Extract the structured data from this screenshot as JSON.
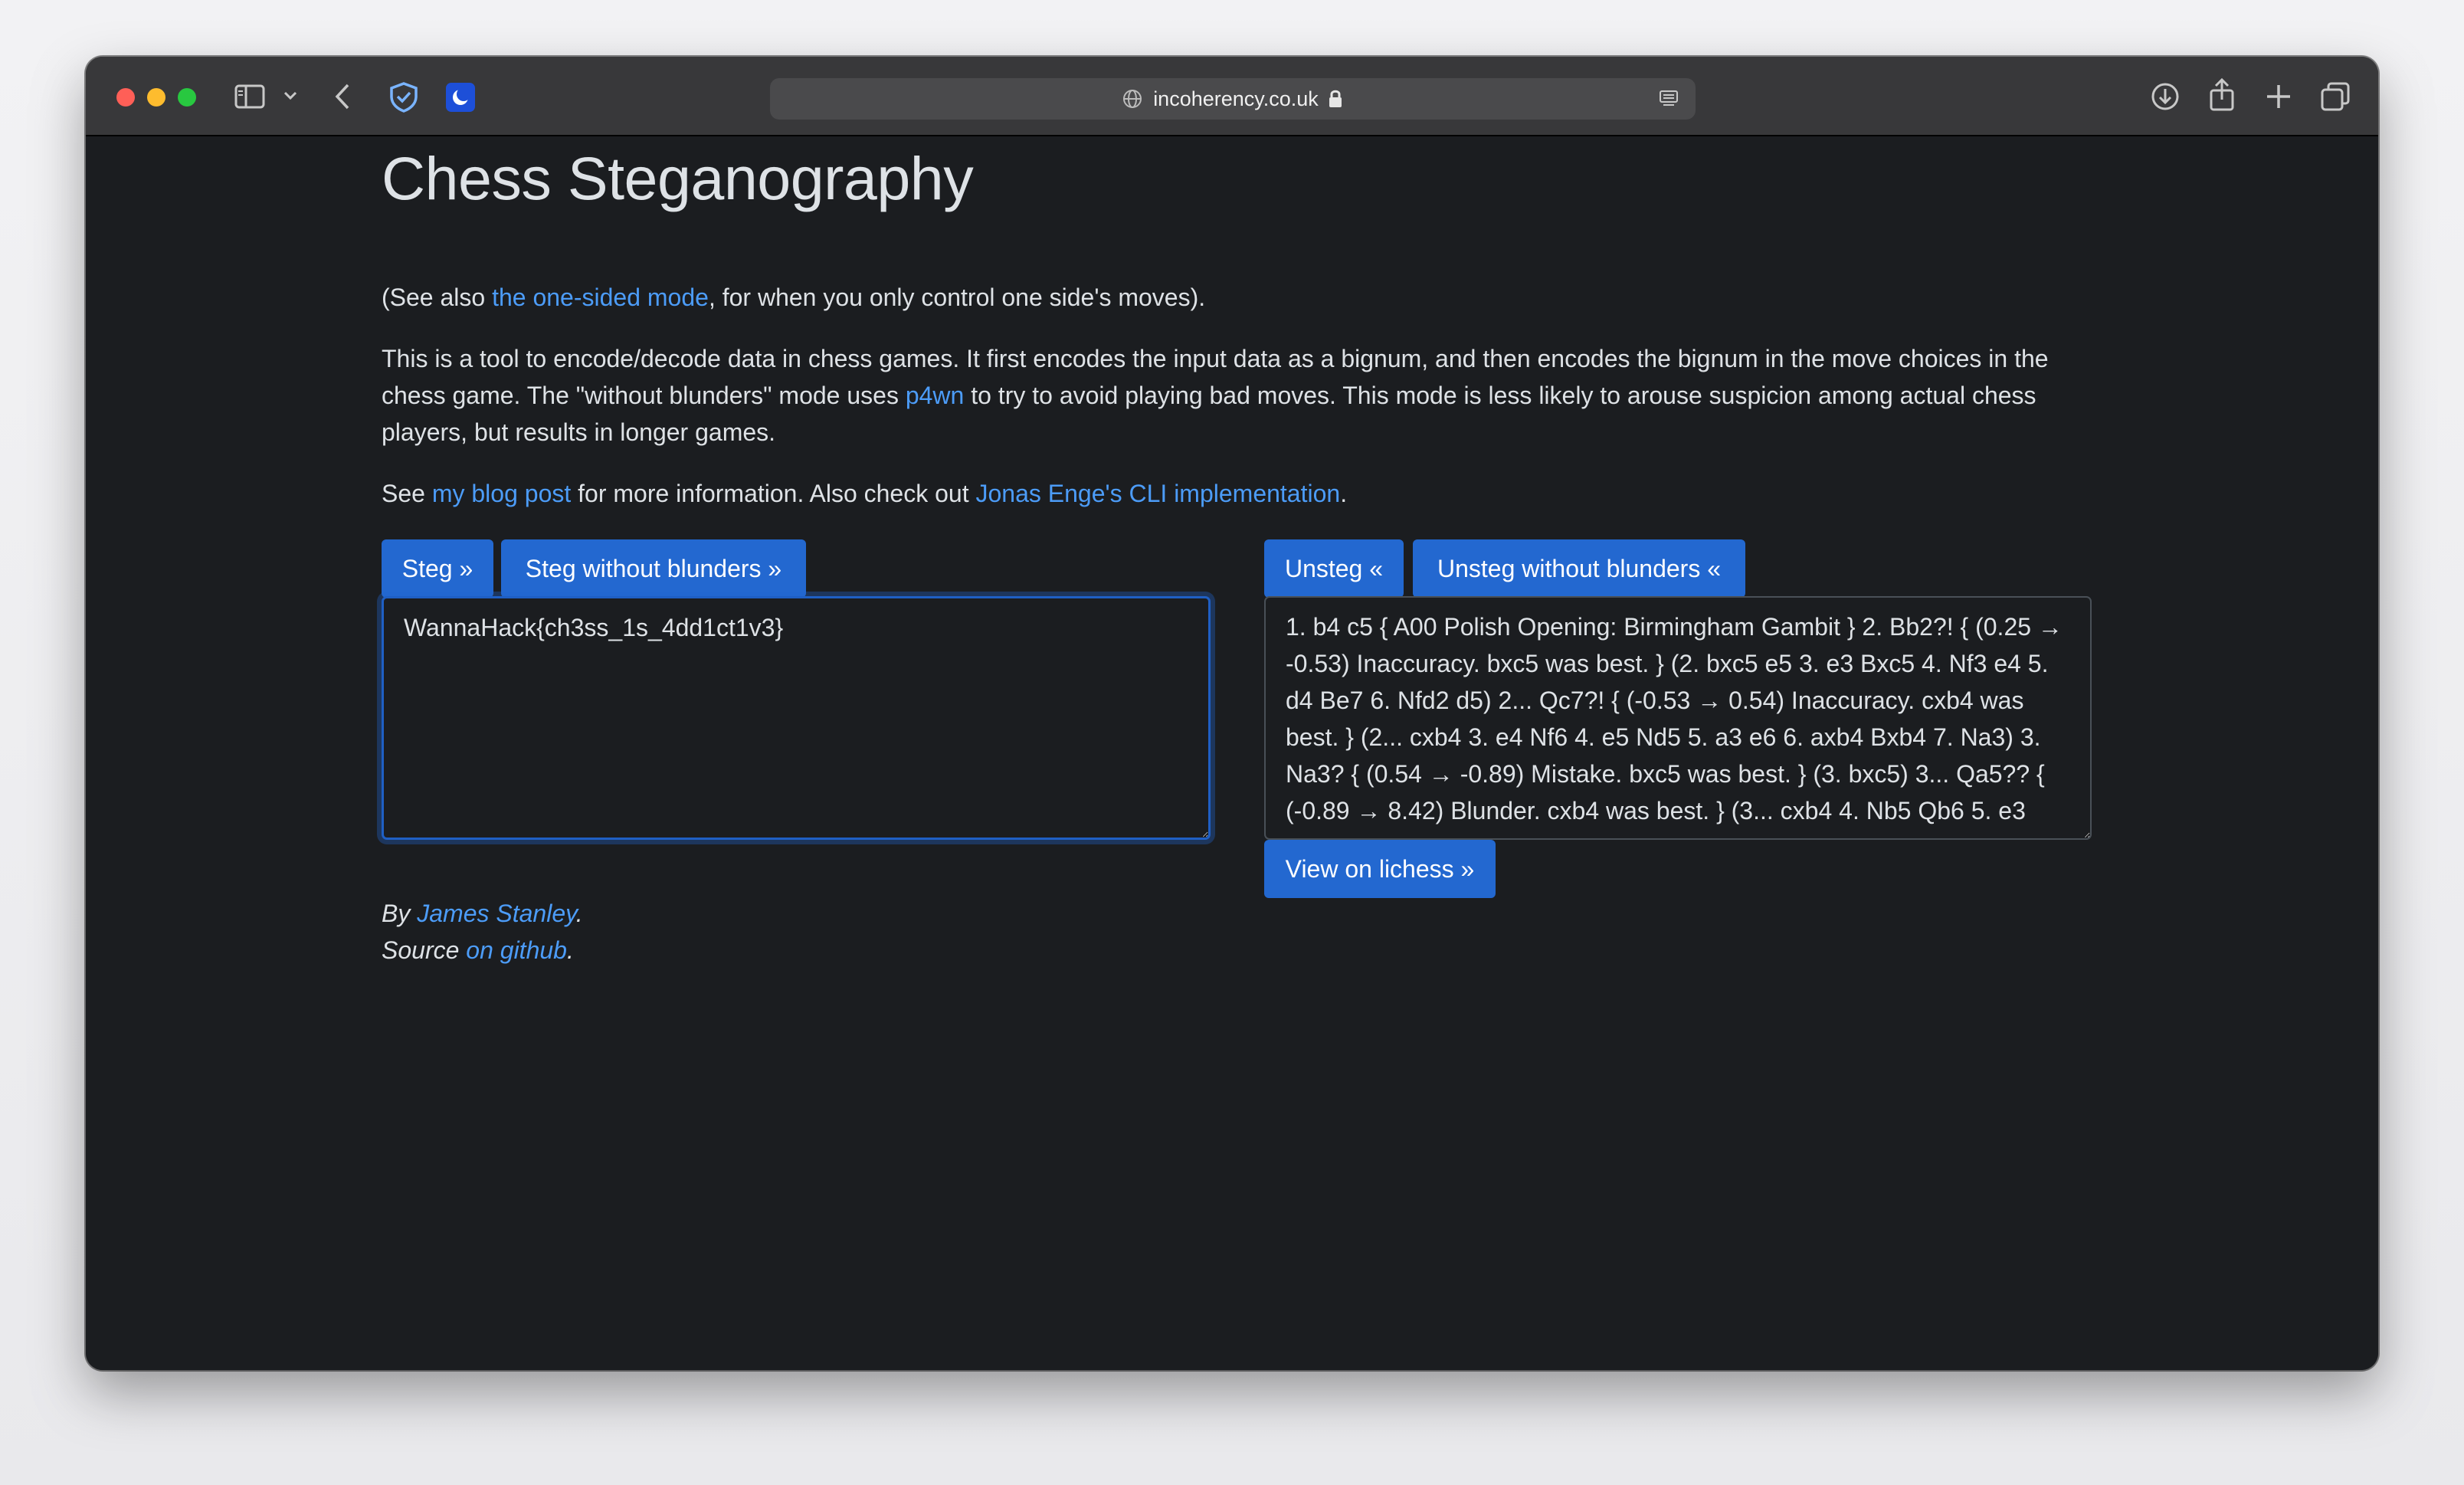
{
  "browser": {
    "url": "incoherency.co.uk"
  },
  "page": {
    "title": "Chess Steganography",
    "see_also": {
      "prefix": "(See also ",
      "link": "the one-sided mode",
      "suffix": ", for when you only control one side's moves)."
    },
    "description": {
      "part1": "This is a tool to encode/decode data in chess games. It first encodes the input data as a bignum, and then encodes the bignum in the move choices in the chess game. The \"without blunders\" mode uses ",
      "link": "p4wn",
      "part2": " to try to avoid playing bad moves. This mode is less likely to arouse suspicion among actual chess players, but results in longer games."
    },
    "info": {
      "prefix": "See ",
      "blog_link": "my blog post",
      "middle": " for more information. Also check out ",
      "cli_link": "Jonas Enge's CLI implementation",
      "suffix": "."
    },
    "buttons": {
      "steg": "Steg »",
      "steg_without_blunders": "Steg without blunders »",
      "unsteg": "Unsteg «",
      "unsteg_without_blunders": "Unsteg without blunders «",
      "view_on_lichess": "View on lichess »"
    },
    "input_text": "WannaHack{ch3ss_1s_4dd1ct1v3}",
    "output_text": "1. b4 c5 { A00 Polish Opening: Birmingham Gambit } 2. Bb2?! { (0.25 → -0.53) Inaccuracy. bxc5 was best. } (2. bxc5 e5 3. e3 Bxc5 4. Nf3 e4 5. d4 Be7 6. Nfd2 d5) 2... Qc7?! { (-0.53 → 0.54) Inaccuracy. cxb4 was best. } (2... cxb4 3. e4 Nf6 4. e5 Nd5 5. a3 e6 6. axb4 Bxb4 7. Na3) 3. Na3? { (0.54 → -0.89) Mistake. bxc5 was best. } (3. bxc5) 3... Qa5?? { (-0.89 → 8.42) Blunder. cxb4 was best. } (3... cxb4 4. Nb5 Qb6 5. e3",
    "footer": {
      "by_prefix": "By ",
      "author": "James Stanley",
      "by_suffix": ".",
      "source_prefix": "Source ",
      "source_link": "on github",
      "source_suffix": "."
    }
  },
  "colors": {
    "background": "#1b1d20",
    "text": "#dee2e6",
    "link": "#4c9cf8",
    "button": "#2368d0"
  }
}
